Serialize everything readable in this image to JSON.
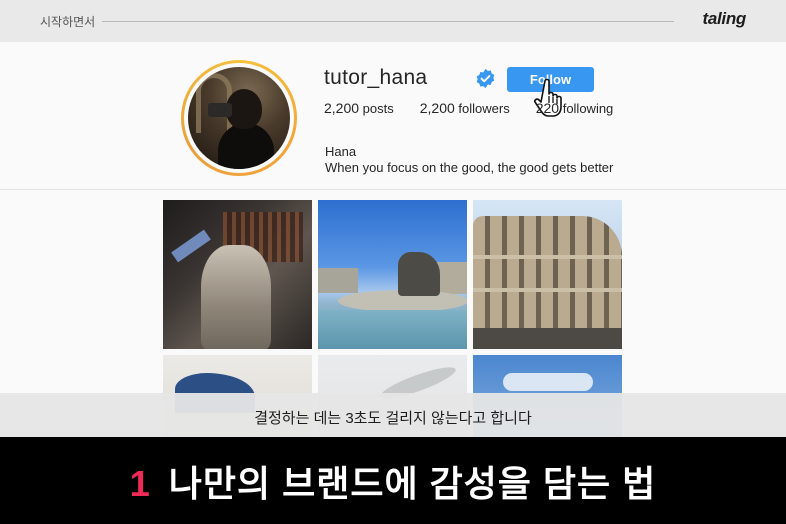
{
  "header": {
    "breadcrumb": "시작하면서",
    "brand": "taling"
  },
  "profile": {
    "username": "tutor_hana",
    "follow_label": "Follow",
    "posts": "2,200",
    "posts_label": "posts",
    "followers": "2,200",
    "followers_label": "followers",
    "following": "220",
    "following_label": "following",
    "full_name": "Hana",
    "bio": "When you focus on the good, the good gets better"
  },
  "grid": {
    "tiles": [
      "sculpture-photo",
      "fountain-photo",
      "colosseum-photo",
      "statue-photo",
      "bird-photo",
      "sky-photo"
    ]
  },
  "caption": "결정하는 데는 3초도 걸리지 않는다고 합니다",
  "lesson": {
    "number": "1",
    "title": "나만의 브랜드에 감성을 담는 법"
  },
  "colors": {
    "follow_blue": "#3897f0",
    "accent_red": "#ee2a55",
    "ring_gold": "#f5c23b"
  }
}
